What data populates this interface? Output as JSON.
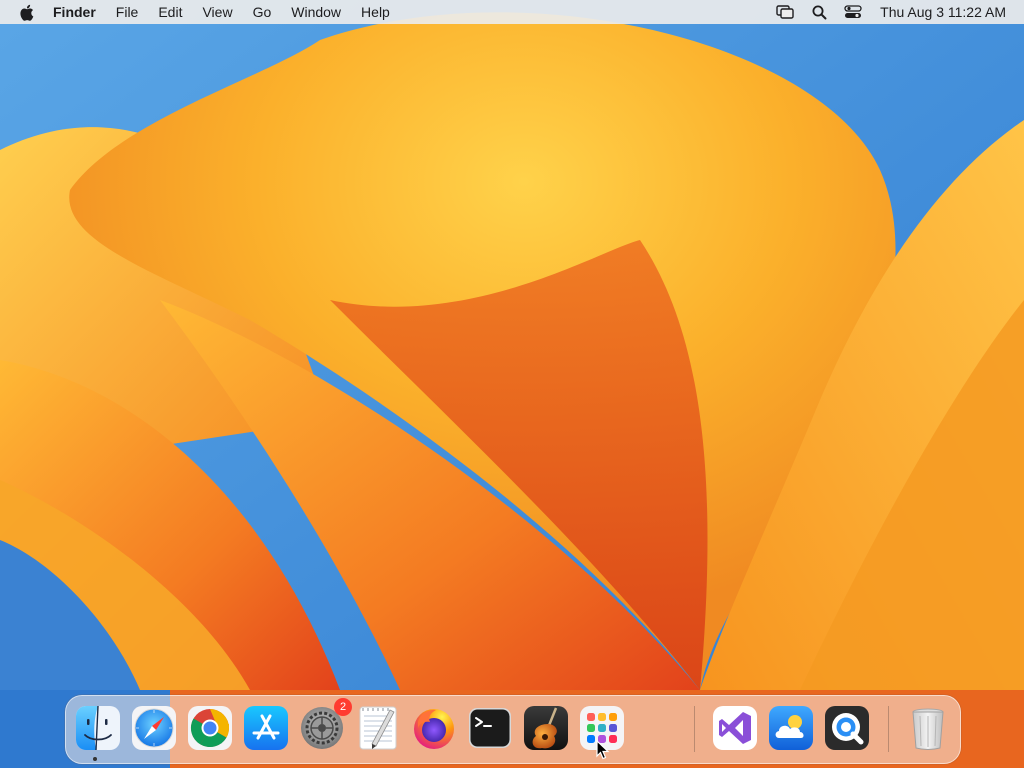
{
  "menubar": {
    "app_name": "Finder",
    "menus": [
      "File",
      "Edit",
      "View",
      "Go",
      "Window",
      "Help"
    ],
    "clock": "Thu Aug 3  11:22 AM",
    "status_icons": [
      "screen-mirroring-icon",
      "spotlight-search-icon",
      "control-center-icon"
    ]
  },
  "dock": {
    "apps": [
      {
        "name": "Finder",
        "icon": "finder-icon",
        "running": true
      },
      {
        "name": "Safari",
        "icon": "safari-icon"
      },
      {
        "name": "Google Chrome",
        "icon": "chrome-icon"
      },
      {
        "name": "App Store",
        "icon": "app-store-icon"
      },
      {
        "name": "System Settings",
        "icon": "system-settings-icon",
        "badge": "2"
      },
      {
        "name": "TextEdit",
        "icon": "textedit-icon"
      },
      {
        "name": "Firefox",
        "icon": "firefox-icon"
      },
      {
        "name": "Terminal",
        "icon": "terminal-icon"
      },
      {
        "name": "GarageBand",
        "icon": "garageband-icon"
      },
      {
        "name": "Launchpad",
        "icon": "launchpad-icon"
      }
    ],
    "recent": [
      {
        "name": "Visual Studio",
        "icon": "visual-studio-icon"
      },
      {
        "name": "Weather",
        "icon": "weather-icon"
      },
      {
        "name": "QuickTime Player",
        "icon": "quicktime-icon"
      }
    ],
    "trash": {
      "name": "Trash",
      "icon": "trash-icon"
    }
  },
  "colors": {
    "wallpaper_orange": "#f7a21b",
    "wallpaper_deep": "#e8531e",
    "wallpaper_blue": "#3f86d4",
    "badge_red": "#ff3b30"
  }
}
